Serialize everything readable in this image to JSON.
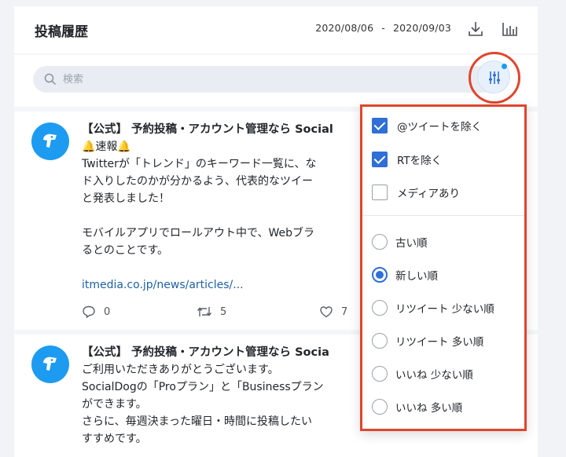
{
  "header": {
    "title": "投稿履歴",
    "date_from": "2020/08/06",
    "date_separator": "-",
    "date_to": "2020/09/03",
    "icons": [
      "download-icon",
      "bar-chart-icon"
    ]
  },
  "search": {
    "placeholder": "検索"
  },
  "posts": [
    {
      "author": "【公式】 予約投稿・アカウント管理なら Social",
      "lines": [
        "🔔速報🔔",
        "Twitterが「トレンド」のキーワード一覧に、な",
        "ド入りしたのかが分かるよう、代表的なツイー",
        "と発表しました！",
        "",
        "モバイルアプリでロールアウト中で、Webブラ",
        "るとのことです。",
        ""
      ],
      "link": "itmedia.co.jp/news/articles/...",
      "replies": "0",
      "retweets": "5",
      "likes": "7"
    },
    {
      "author": "【公式】 予約投稿・アカウント管理なら Socia",
      "lines": [
        "ご利用いただきありがとうございます。",
        "SocialDogの「Proプラン」と「Businessプラン",
        "ができます。",
        "さらに、毎週決まった曜日・時間に投稿したい",
        "すすめです。"
      ]
    }
  ],
  "filter_menu": {
    "checkboxes": [
      {
        "label": "@ツイートを除く",
        "checked": true
      },
      {
        "label": "RTを除く",
        "checked": true
      },
      {
        "label": "メディアあり",
        "checked": false
      }
    ],
    "sort_options": [
      {
        "label": "古い順",
        "selected": false
      },
      {
        "label": "新しい順",
        "selected": true
      },
      {
        "label": "リツイート 少ない順",
        "selected": false
      },
      {
        "label": "リツイート 多い順",
        "selected": false
      },
      {
        "label": "いいね 少ない順",
        "selected": false
      },
      {
        "label": "いいね 多い順",
        "selected": false
      }
    ]
  },
  "colors": {
    "accent": "#2f6fd6",
    "avatar": "#1d9bf0",
    "highlight": "#e0452d",
    "link": "#1f5fa6"
  }
}
